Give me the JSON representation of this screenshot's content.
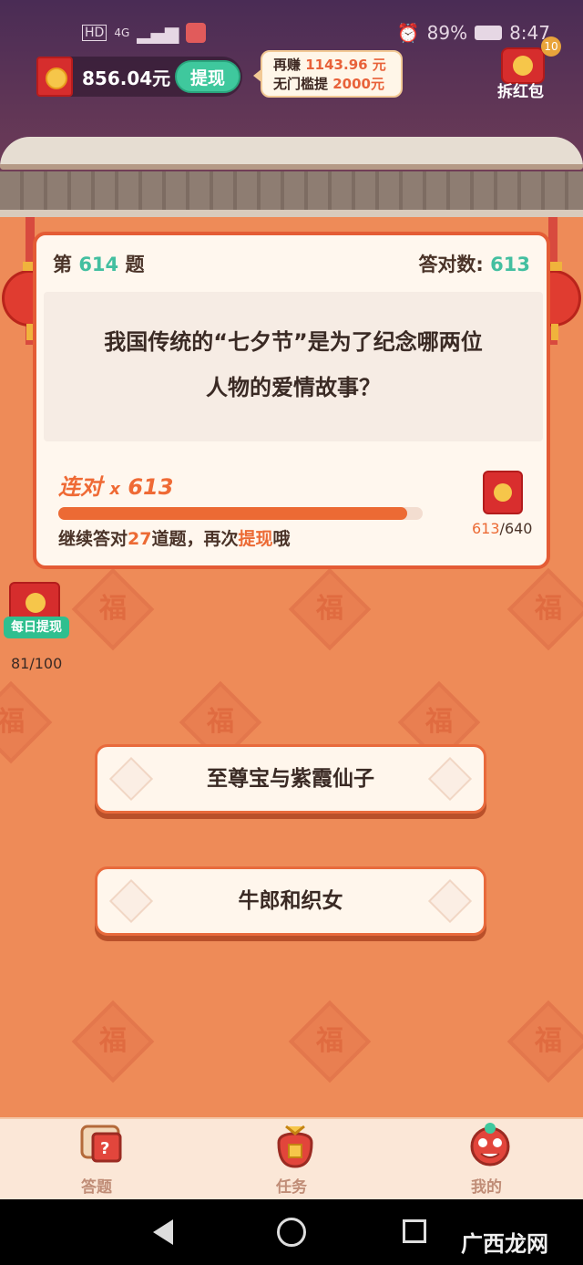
{
  "status_bar": {
    "hd": "HD",
    "network": "4G",
    "battery": "89%",
    "time": "8:47"
  },
  "header": {
    "balance": "856.04元",
    "withdraw_label": "提现",
    "tip_line1_prefix": "再赚",
    "tip_line1_amount": "1143.96 元",
    "tip_line2_prefix": "无门槛提",
    "tip_line2_amount": "2000元",
    "redpack_badge": "10",
    "redpack_label": "拆红包"
  },
  "card": {
    "question_prefix": "第",
    "question_number": "614",
    "question_suffix": "题",
    "correct_label": "答对数:",
    "correct_count": "613",
    "question_line1": "我国传统的“七夕节”是为了纪念哪两位",
    "question_line2": "人物的爱情故事？",
    "combo_label": "连对",
    "combo_x": "x",
    "combo_count": "613",
    "progress": 0.958,
    "continue_prefix": "继续答对",
    "continue_number": "27",
    "continue_mid": "道题，再次",
    "continue_action": "提现",
    "continue_suffix": "哦",
    "pack_current": "613",
    "pack_total": "/640"
  },
  "daily": {
    "label": "每日提现",
    "count": "81/100"
  },
  "answers": [
    "至尊宝与紫霞仙子",
    "牛郎和织女"
  ],
  "decor": {
    "fu": "福"
  },
  "bottom_nav": [
    {
      "label": "答题",
      "icon": "quiz-icon"
    },
    {
      "label": "任务",
      "icon": "task-bag-icon"
    },
    {
      "label": "我的",
      "icon": "lion-dance-icon"
    }
  ],
  "watermark": "广西龙网",
  "colors": {
    "accent": "#ec6a34",
    "teal": "#43bfa0",
    "red": "#d62d2d"
  }
}
